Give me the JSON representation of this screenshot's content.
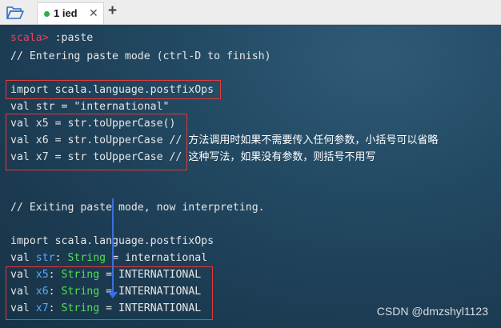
{
  "tab": {
    "label": "1 ied",
    "close": "✕"
  },
  "add_tab": "+",
  "lines": {
    "l1_prompt": "scala>",
    "l1_cmd": " :paste",
    "l2": "// Entering paste mode (ctrl-D to finish)",
    "l3": "import scala.language.postfixOps",
    "l4": "val str = \"international\"",
    "l5": "val x5 = str.toUpperCase()",
    "l6_code": "val x6 = str.toUpperCase // ",
    "l6_comment": "方法调用时如果不需要传入任何参数，小括号可以省略",
    "l7_code": "val x7 = str toUpperCase // ",
    "l7_comment": "这种写法，如果没有参数，则括号不用写",
    "l8": "// Exiting paste mode, now interpreting.",
    "l9": "import scala.language.postfixOps",
    "r1": {
      "val": "val ",
      "name": "str",
      "colon": ": ",
      "type": "String",
      "rest": " = international"
    },
    "r2": {
      "val": "val ",
      "name": "x5",
      "colon": ": ",
      "type": "String",
      "rest": " = INTERNATIONAL"
    },
    "r3": {
      "val": "val ",
      "name": "x6",
      "colon": ": ",
      "type": "String",
      "rest": " = INTERNATIONAL"
    },
    "r4": {
      "val": "val ",
      "name": "x7",
      "colon": ": ",
      "type": "String",
      "rest": " = INTERNATIONAL"
    }
  },
  "watermark": "CSDN @dmzshyl1123",
  "colors": {
    "prompt": "#e8415e",
    "identifier": "#5aa8ff",
    "type": "#52e052",
    "highlight_box": "#e03a3a",
    "arrow": "#3b6fe0",
    "active_dot": "#2eac4a"
  },
  "icons": [
    "folder-open-icon",
    "close-icon",
    "plus-icon"
  ]
}
